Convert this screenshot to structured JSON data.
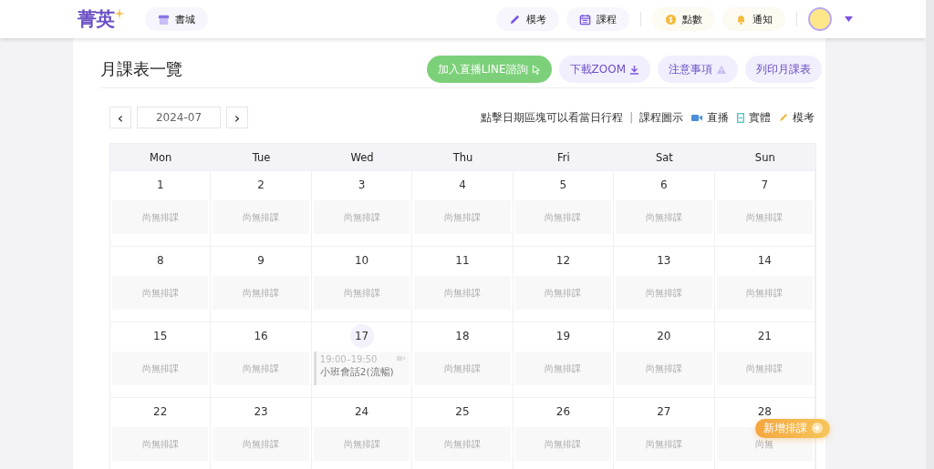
{
  "header": {
    "logo": "菁英",
    "nav_left": [
      {
        "label": "書城",
        "kind": "store"
      }
    ],
    "nav_right": [
      {
        "label": "模考",
        "kind": "pencil"
      },
      {
        "label": "課程",
        "kind": "calendar"
      },
      {
        "label": "點數",
        "kind": "coin"
      },
      {
        "label": "通知",
        "kind": "bell"
      }
    ]
  },
  "page": {
    "title": "月課表一覽",
    "actions": [
      {
        "label": "加入直播LINE諮詢",
        "kind": "primary"
      },
      {
        "label": "下載ZOOM",
        "kind": "download"
      },
      {
        "label": "注意事項",
        "kind": "warning"
      },
      {
        "label": "列印月課表",
        "kind": "plain"
      }
    ],
    "month": {
      "prev": "‹",
      "value": "2024-07",
      "next": "›"
    },
    "legend": {
      "hint": "點擊日期區塊可以看當日行程",
      "separator": "|",
      "caption": "課程圖示",
      "items": [
        {
          "label": "直播",
          "kind": "video"
        },
        {
          "label": "實體",
          "kind": "building"
        },
        {
          "label": "模考",
          "kind": "pencil"
        }
      ]
    }
  },
  "calendar": {
    "weekdays": [
      "Mon",
      "Tue",
      "Wed",
      "Thu",
      "Fri",
      "Sat",
      "Sun"
    ],
    "weeks": [
      [
        {
          "date": "1",
          "today": false,
          "empty": "尚無排課"
        },
        {
          "date": "2",
          "today": false,
          "empty": "尚無排課"
        },
        {
          "date": "3",
          "today": false,
          "empty": "尚無排課"
        },
        {
          "date": "4",
          "today": false,
          "empty": "尚無排課"
        },
        {
          "date": "5",
          "today": false,
          "empty": "尚無排課"
        },
        {
          "date": "6",
          "today": false,
          "empty": "尚無排課"
        },
        {
          "date": "7",
          "today": false,
          "empty": "尚無排課"
        }
      ],
      [
        {
          "date": "8",
          "today": false,
          "empty": "尚無排課"
        },
        {
          "date": "9",
          "today": false,
          "empty": "尚無排課"
        },
        {
          "date": "10",
          "today": false,
          "empty": "尚無排課"
        },
        {
          "date": "11",
          "today": false,
          "empty": "尚無排課"
        },
        {
          "date": "12",
          "today": false,
          "empty": "尚無排課"
        },
        {
          "date": "13",
          "today": false,
          "empty": "尚無排課"
        },
        {
          "date": "14",
          "today": false,
          "empty": "尚無排課"
        }
      ],
      [
        {
          "date": "15",
          "today": false,
          "empty": "尚無排課"
        },
        {
          "date": "16",
          "today": false,
          "empty": "尚無排課"
        },
        {
          "date": "17",
          "today": true,
          "events": [
            {
              "time": "19:00–19:50",
              "title": "小班會話2(流暢)",
              "kind": "live"
            }
          ]
        },
        {
          "date": "18",
          "today": false,
          "empty": "尚無排課"
        },
        {
          "date": "19",
          "today": false,
          "empty": "尚無排課"
        },
        {
          "date": "20",
          "today": false,
          "empty": "尚無排課"
        },
        {
          "date": "21",
          "today": false,
          "empty": "尚無排課"
        }
      ],
      [
        {
          "date": "22",
          "today": false,
          "empty": "尚無排課"
        },
        {
          "date": "23",
          "today": false,
          "empty": "尚無排課"
        },
        {
          "date": "24",
          "today": false,
          "empty": "尚無排課"
        },
        {
          "date": "25",
          "today": false,
          "empty": "尚無排課"
        },
        {
          "date": "26",
          "today": false,
          "empty": "尚無排課"
        },
        {
          "date": "27",
          "today": false,
          "empty": "尚無排課"
        },
        {
          "date": "28",
          "today": false,
          "empty": "尚無"
        }
      ]
    ]
  },
  "fab": {
    "label": "新增排課"
  }
}
